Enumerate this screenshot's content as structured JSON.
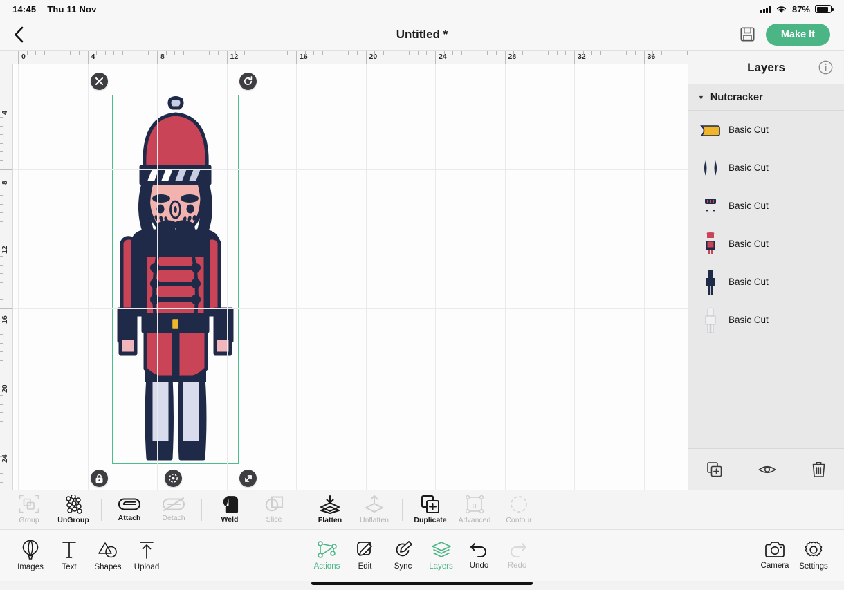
{
  "status_bar": {
    "time": "14:45",
    "date": "Thu 11 Nov",
    "battery_percent": "87%",
    "icons": [
      "cellular-signal-icon",
      "wifi-icon",
      "battery-icon"
    ]
  },
  "top_bar": {
    "back_icon": "chevron-left-icon",
    "title": "Untitled *",
    "save_icon": "save-icon",
    "make_it_label": "Make It",
    "accent_color": "#4cb585"
  },
  "canvas": {
    "ruler_horizontal": [
      "0",
      "4",
      "8",
      "12",
      "16",
      "20",
      "24",
      "28",
      "32",
      "36"
    ],
    "ruler_vertical": [
      "4",
      "8",
      "12",
      "16",
      "20",
      "24"
    ],
    "selection": {
      "color": "#4cbd8d",
      "handles": [
        {
          "name": "delete-handle",
          "icon": "close-icon"
        },
        {
          "name": "rotate-handle",
          "icon": "rotate-icon"
        },
        {
          "name": "lock-handle",
          "icon": "lock-icon"
        },
        {
          "name": "move-handle",
          "icon": "move-icon"
        },
        {
          "name": "resize-handle",
          "icon": "resize-icon"
        }
      ]
    },
    "artwork": {
      "name": "nutcracker-artwork",
      "colors": {
        "navy": "#1e2a47",
        "red": "#c94456",
        "skin": "#f2b3ae",
        "pink": "#f0b6bb",
        "lavender": "#d9dced",
        "gold": "#efb62c",
        "white": "#ffffff"
      }
    }
  },
  "layers_panel": {
    "title": "Layers",
    "info_icon": "info-icon",
    "group": {
      "name": "Nutcracker",
      "expanded": true,
      "caret_icon": "caret-down-icon"
    },
    "layers": [
      {
        "label": "Basic Cut",
        "thumb": "gold-shape-thumb"
      },
      {
        "label": "Basic Cut",
        "thumb": "navy-arms-thumb"
      },
      {
        "label": "Basic Cut",
        "thumb": "navy-hat-brim-thumb"
      },
      {
        "label": "Basic Cut",
        "thumb": "red-coat-thumb"
      },
      {
        "label": "Basic Cut",
        "thumb": "navy-body-thumb"
      },
      {
        "label": "Basic Cut",
        "thumb": "white-body-thumb"
      }
    ],
    "footer_buttons": [
      {
        "name": "duplicate-layer-button",
        "icon": "duplicate-icon"
      },
      {
        "name": "visibility-button",
        "icon": "eye-icon"
      },
      {
        "name": "delete-layer-button",
        "icon": "trash-icon"
      }
    ]
  },
  "action_bar": [
    {
      "label": "Group",
      "icon": "group-icon",
      "enabled": false
    },
    {
      "label": "UnGroup",
      "icon": "ungroup-icon",
      "enabled": true
    },
    {
      "label": "Attach",
      "icon": "attach-icon",
      "enabled": true
    },
    {
      "label": "Detach",
      "icon": "detach-icon",
      "enabled": false
    },
    {
      "label": "Weld",
      "icon": "weld-icon",
      "enabled": true
    },
    {
      "label": "Slice",
      "icon": "slice-icon",
      "enabled": false
    },
    {
      "label": "Flatten",
      "icon": "flatten-icon",
      "enabled": true
    },
    {
      "label": "Unflatten",
      "icon": "unflatten-icon",
      "enabled": false
    },
    {
      "label": "Duplicate",
      "icon": "duplicate-icon",
      "enabled": true
    },
    {
      "label": "Advanced",
      "icon": "advanced-icon",
      "enabled": false
    },
    {
      "label": "Contour",
      "icon": "contour-icon",
      "enabled": false
    }
  ],
  "bottom_nav": {
    "left": [
      {
        "label": "Images",
        "icon": "balloon-icon",
        "state": "normal"
      },
      {
        "label": "Text",
        "icon": "text-icon",
        "state": "normal"
      },
      {
        "label": "Shapes",
        "icon": "shapes-icon",
        "state": "normal"
      },
      {
        "label": "Upload",
        "icon": "upload-icon",
        "state": "normal"
      }
    ],
    "center": [
      {
        "label": "Actions",
        "icon": "actions-icon",
        "state": "active"
      },
      {
        "label": "Edit",
        "icon": "edit-icon",
        "state": "normal"
      },
      {
        "label": "Sync",
        "icon": "sync-icon",
        "state": "normal"
      },
      {
        "label": "Layers",
        "icon": "layers-icon",
        "state": "active"
      },
      {
        "label": "Undo",
        "icon": "undo-icon",
        "state": "normal"
      },
      {
        "label": "Redo",
        "icon": "redo-icon",
        "state": "disabled"
      }
    ],
    "right": [
      {
        "label": "Camera",
        "icon": "camera-icon",
        "state": "normal"
      },
      {
        "label": "Settings",
        "icon": "gear-icon",
        "state": "normal"
      }
    ]
  }
}
